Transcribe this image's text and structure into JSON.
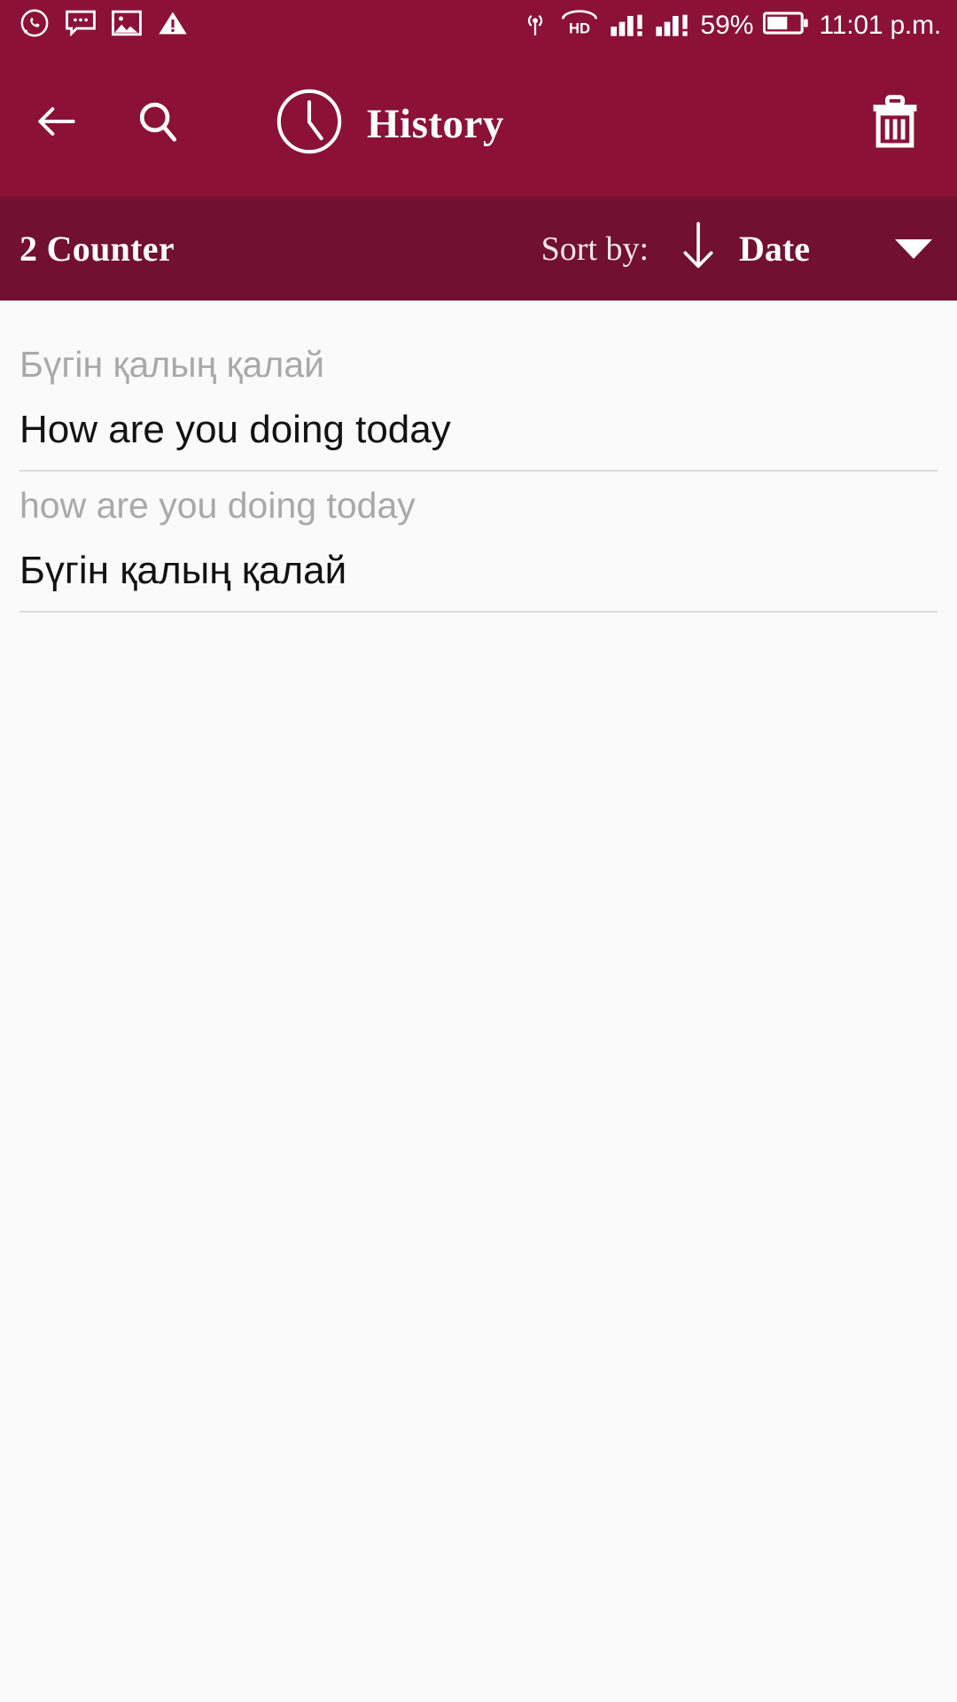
{
  "status_bar": {
    "left_icons": [
      "whatsapp-icon",
      "message-icon",
      "photo-icon",
      "warning-icon"
    ],
    "hotspot_icon": "hotspot-icon",
    "volte_label": "HD",
    "signal_icon_1": "signal-bars-warning-icon",
    "signal_icon_2": "signal-bars-warning-icon",
    "battery_percent": "59%",
    "battery_icon": "battery-icon",
    "time": "11:01 p.m."
  },
  "app_bar": {
    "back_icon": "arrow-left-icon",
    "search_icon": "search-icon",
    "clock_icon": "clock-icon",
    "title": "History",
    "delete_icon": "trash-icon"
  },
  "sub_bar": {
    "counter": "2 Counter",
    "sort_label": "Sort by:",
    "sort_direction_icon": "arrow-down-icon",
    "sort_value": "Date",
    "dropdown_icon": "caret-down-icon"
  },
  "history": {
    "items": [
      {
        "source": "Бүгін қалың қалай",
        "target": "How are you doing today"
      },
      {
        "source": "how are you doing today",
        "target": "Бүгін қалың қалай"
      }
    ]
  },
  "colors": {
    "primary": "#8b1139",
    "primary_dark": "#711030",
    "background": "#fafafa",
    "source_text": "#a9a9a9",
    "target_text": "#121212",
    "divider": "#dcdcdc"
  }
}
